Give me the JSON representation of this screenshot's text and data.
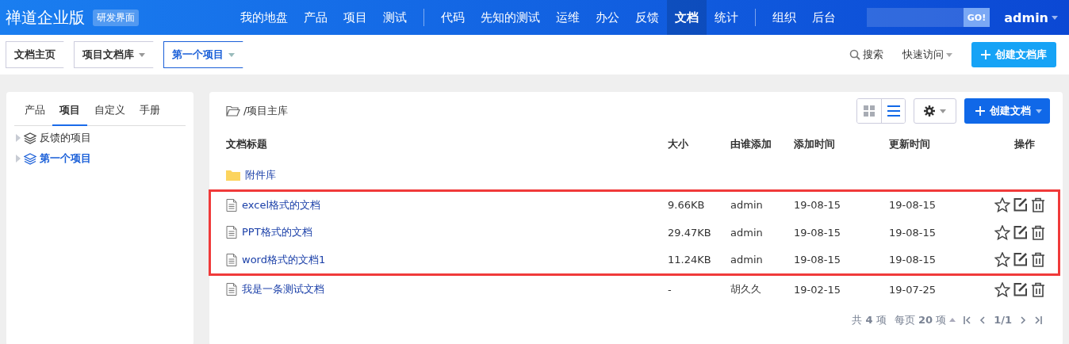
{
  "brand": {
    "title": "禅道企业版",
    "badge": "研发界面"
  },
  "nav_groups": [
    [
      {
        "label": "我的地盘",
        "selected": false
      },
      {
        "label": "产品",
        "selected": false
      },
      {
        "label": "项目",
        "selected": false
      },
      {
        "label": "测试",
        "selected": false
      }
    ],
    [
      {
        "label": "代码",
        "selected": false
      },
      {
        "label": "先知的测试",
        "selected": false
      },
      {
        "label": "运维",
        "selected": false
      },
      {
        "label": "办公",
        "selected": false
      },
      {
        "label": "反馈",
        "selected": false
      },
      {
        "label": "文档",
        "selected": true
      },
      {
        "label": "统计",
        "selected": false
      }
    ],
    [
      {
        "label": "组织",
        "selected": false
      },
      {
        "label": "后台",
        "selected": false
      }
    ]
  ],
  "search": {
    "button": "GO!"
  },
  "user": "admin",
  "breadcrumbs": [
    {
      "label": "文档主页",
      "dropdown": false,
      "selected": false
    },
    {
      "label": "项目文档库",
      "dropdown": true,
      "selected": false
    },
    {
      "label": "第一个项目",
      "dropdown": true,
      "selected": true
    }
  ],
  "toolbar": {
    "search": "搜索",
    "quick_access": "快速访问",
    "create": "创建文档库"
  },
  "sidebar": {
    "tabs": [
      {
        "label": "产品",
        "selected": false
      },
      {
        "label": "项目",
        "selected": true
      },
      {
        "label": "自定义",
        "selected": false
      },
      {
        "label": "手册",
        "selected": false
      }
    ],
    "tree": [
      {
        "label": "反馈的项目",
        "selected": false,
        "expanded": false
      },
      {
        "label": "第一个项目",
        "selected": true,
        "expanded": false
      }
    ]
  },
  "library": {
    "path": "/项目主库",
    "view_modes": [
      {
        "kind": "grid",
        "selected": false
      },
      {
        "kind": "list",
        "selected": true
      }
    ],
    "create": "创建文档",
    "columns": [
      "文档标题",
      "大小",
      "由谁添加",
      "添加时间",
      "更新时间",
      "操作"
    ],
    "rows": [
      {
        "kind": "folder",
        "title": "附件库",
        "highlighted": false
      },
      {
        "kind": "doc",
        "title": "excel格式的文档",
        "size": "9.66KB",
        "added_by": "admin",
        "added": "19-08-15",
        "updated": "19-08-15",
        "highlighted": true
      },
      {
        "kind": "doc",
        "title": "PPT格式的文档",
        "size": "29.47KB",
        "added_by": "admin",
        "added": "19-08-15",
        "updated": "19-08-15",
        "highlighted": true
      },
      {
        "kind": "doc",
        "title": "word格式的文档1",
        "size": "11.24KB",
        "added_by": "admin",
        "added": "19-08-15",
        "updated": "19-08-15",
        "highlighted": true
      },
      {
        "kind": "doc",
        "title": "我是一条测试文档",
        "size": "-",
        "added_by": "胡久久",
        "added": "19-02-15",
        "updated": "19-07-25",
        "highlighted": false
      }
    ],
    "pagination": {
      "total": "共 **4** 项",
      "per_page": "每页 **20** 项",
      "page": "1/1"
    }
  }
}
